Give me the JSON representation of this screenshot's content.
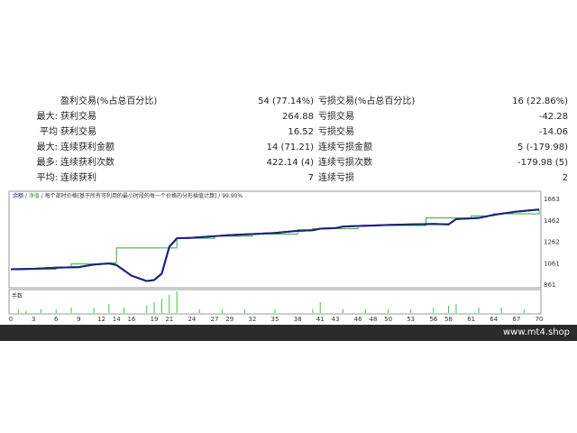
{
  "stats": [
    {
      "c1": "",
      "c2": "盈利交易(%占总百分比)",
      "c3": "54 (77.14%)",
      "c4": "亏损交易(%占总百分比)",
      "c5": "16 (22.86%)"
    },
    {
      "c1": "最大:",
      "c2": "获利交易",
      "c3": "264.88",
      "c4": "亏损交易",
      "c5": "-42.28"
    },
    {
      "c1": "平均",
      "c2": "获利交易",
      "c3": "16.52",
      "c4": "亏损交易",
      "c5": "-14.06"
    },
    {
      "c1": "最大:",
      "c2": "连续获利金额",
      "c3": "14 (71.21)",
      "c4": "连续亏损金额",
      "c5": "5 (-179.98)"
    },
    {
      "c1": "最多:",
      "c2": "连续获利次数",
      "c3": "422.14 (4)",
      "c4": "连续亏损次数",
      "c5": "-179.98 (5)"
    },
    {
      "c1": "平均:",
      "c2": "连续获利",
      "c3": "7",
      "c4": "连续亏损",
      "c5": "2"
    }
  ],
  "chart_data": {
    "type": "line",
    "legend": {
      "balance": "余额",
      "equity": "净值",
      "text": "每个部时价格[基于所有可利用的最小时段的每一个价格的分形插值计算]",
      "quality": "99.90%"
    },
    "volume_label": "手数",
    "yticks": [
      1663,
      1462,
      1262,
      1061,
      861
    ],
    "ylim": [
      861,
      1663
    ],
    "xticks": [
      0,
      3,
      6,
      9,
      12,
      14,
      16,
      19,
      21,
      24,
      27,
      29,
      32,
      35,
      38,
      41,
      43,
      46,
      48,
      50,
      53,
      56,
      58,
      61,
      64,
      67,
      70
    ],
    "xlim": [
      0,
      70
    ],
    "series": [
      {
        "name": "余额",
        "color": "#1a237e",
        "x": [
          0,
          3,
          6,
          9,
          11,
          13,
          14,
          16,
          18,
          19,
          20,
          21,
          22,
          24,
          25,
          27,
          29,
          32,
          35,
          38,
          40,
          41,
          43,
          44,
          46,
          48,
          50,
          53,
          56,
          58,
          59,
          62,
          64,
          67,
          70
        ],
        "y": [
          1000,
          1005,
          1015,
          1020,
          1045,
          1055,
          1040,
          940,
          890,
          900,
          960,
          1210,
          1290,
          1295,
          1300,
          1310,
          1320,
          1330,
          1340,
          1360,
          1365,
          1380,
          1385,
          1400,
          1405,
          1410,
          1415,
          1420,
          1425,
          1420,
          1470,
          1480,
          1510,
          1540,
          1560
        ]
      },
      {
        "name": "净值",
        "color": "#33aa33",
        "x": [
          0,
          6,
          8,
          11,
          13,
          14,
          21,
          22,
          27,
          32,
          38,
          40,
          46,
          55,
          56,
          58,
          61,
          64,
          70
        ],
        "y": [
          1000,
          1015,
          1050,
          1050,
          1060,
          1200,
          1200,
          1290,
          1310,
          1330,
          1370,
          1380,
          1410,
          1480,
          1480,
          1480,
          1500,
          1520,
          1560
        ]
      }
    ],
    "volume": {
      "x": [
        1,
        2,
        4,
        6,
        8,
        11,
        13,
        15,
        18,
        19,
        20,
        21,
        22,
        25,
        28,
        31,
        35,
        40,
        41,
        44,
        47,
        50,
        53,
        56,
        58,
        59,
        62,
        65,
        68
      ],
      "v": [
        0.2,
        0.1,
        0.2,
        0.2,
        0.3,
        0.3,
        0.5,
        0.3,
        0.4,
        0.6,
        0.8,
        1.0,
        1.2,
        0.2,
        0.2,
        0.2,
        0.2,
        0.2,
        0.6,
        0.2,
        0.2,
        0.2,
        0.2,
        0.3,
        0.4,
        0.5,
        0.3,
        0.3,
        0.2
      ]
    }
  },
  "footer": {
    "site": "www.mt4.shop"
  }
}
